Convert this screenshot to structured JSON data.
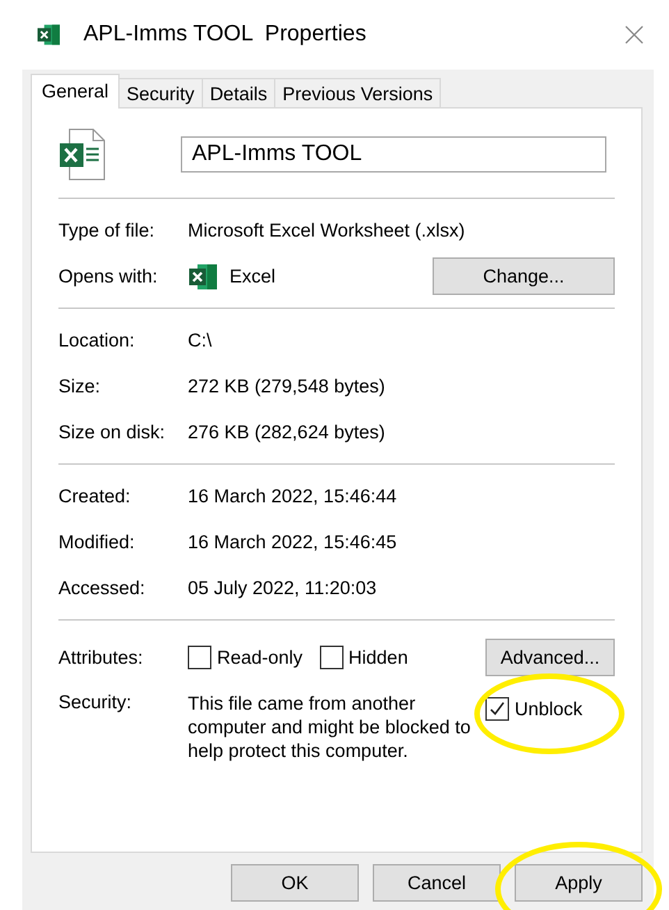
{
  "window": {
    "title": "APL-Imms TOOL  Properties"
  },
  "tabs": [
    {
      "label": "General",
      "selected": true
    },
    {
      "label": "Security",
      "selected": false
    },
    {
      "label": "Details",
      "selected": false
    },
    {
      "label": "Previous Versions",
      "selected": false
    }
  ],
  "file_name": {
    "value": "APL-Imms TOOL"
  },
  "sections": [
    {
      "rows": [
        {
          "kind": "text",
          "label": "Type of file:",
          "value": "Microsoft Excel Worksheet (.xlsx)"
        },
        {
          "kind": "app",
          "label": "Opens with:",
          "value": "Excel",
          "button": "Change..."
        }
      ]
    },
    {
      "rows": [
        {
          "kind": "text",
          "label": "Location:",
          "value": "C:\\"
        },
        {
          "kind": "text",
          "label": "Size:",
          "value": "272 KB (279,548 bytes)"
        },
        {
          "kind": "text",
          "label": "Size on disk:",
          "value": "276 KB (282,624 bytes)"
        }
      ]
    },
    {
      "rows": [
        {
          "kind": "text",
          "label": "Created:",
          "value": "16 March 2022, 15:46:44"
        },
        {
          "kind": "text",
          "label": "Modified:",
          "value": "16 March 2022, 15:46:45"
        },
        {
          "kind": "text",
          "label": "Accessed:",
          "value": "05 July 2022, 11:20:03"
        }
      ]
    }
  ],
  "attributes": {
    "label": "Attributes:",
    "options": [
      {
        "label": "Read-only",
        "checked": false
      },
      {
        "label": "Hidden",
        "checked": false
      }
    ],
    "button": "Advanced..."
  },
  "security": {
    "label": "Security:",
    "text": "This file came from another computer and might be blocked to help protect this computer.",
    "checkbox": {
      "label": "Unblock",
      "checked": true,
      "highlighted": true
    }
  },
  "buttons": [
    {
      "label": "OK",
      "highlighted": false
    },
    {
      "label": "Cancel",
      "highlighted": false
    },
    {
      "label": "Apply",
      "highlighted": true
    }
  ]
}
